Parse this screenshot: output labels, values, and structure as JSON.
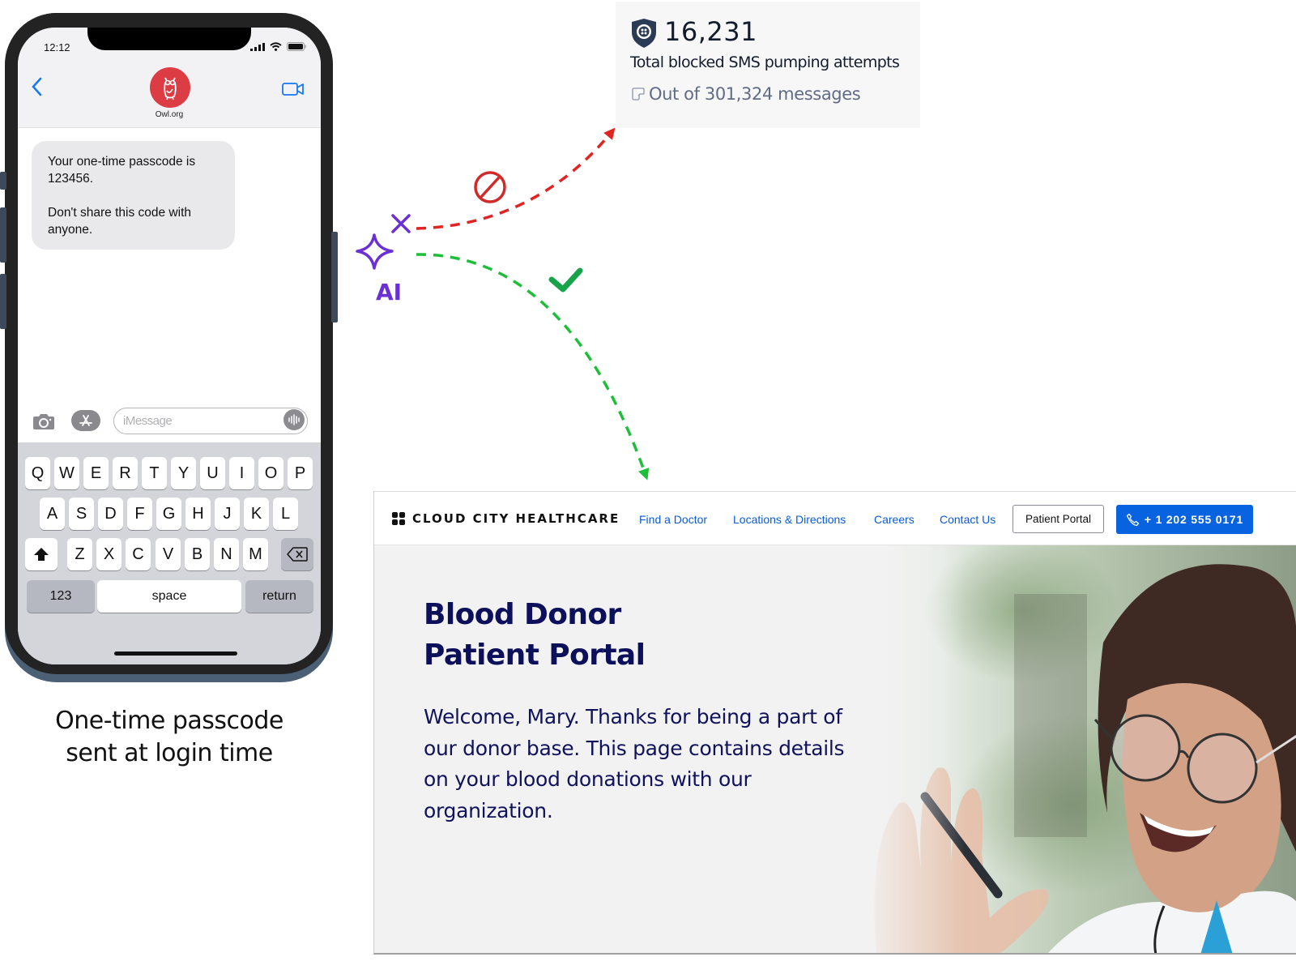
{
  "phone": {
    "status_time": "12:12",
    "contact_name": "Owl.org",
    "messages": [
      {
        "lines": [
          "Your one-time passcode is",
          "123456."
        ],
        "lines2": [
          "Don't share this code with",
          "anyone."
        ]
      }
    ],
    "input_placeholder": "iMessage",
    "keyboard": {
      "row1": [
        "Q",
        "W",
        "E",
        "R",
        "T",
        "Y",
        "U",
        "I",
        "O",
        "P"
      ],
      "row2": [
        "A",
        "S",
        "D",
        "F",
        "G",
        "H",
        "J",
        "K",
        "L"
      ],
      "row3": [
        "Z",
        "X",
        "C",
        "V",
        "B",
        "N",
        "M"
      ],
      "numbers_label": "123",
      "space_label": "space",
      "return_label": "return"
    },
    "caption_line1": "One-time passcode",
    "caption_line2": "sent at login time"
  },
  "stats": {
    "value": "16,231",
    "label": "Total blocked SMS pumping attempts",
    "sub_label": "Out of 301,324 messages"
  },
  "flow": {
    "ai_label": "AI",
    "blocked_color": "#e02424",
    "allowed_color": "#1fbe3a",
    "ai_color": "#6a2fd5"
  },
  "site": {
    "brand_name": "CLOUD CITY HEALTHCARE",
    "nav": [
      "Find a Doctor",
      "Locations & Directions",
      "Careers",
      "Contact Us"
    ],
    "portal_button": "Patient Portal",
    "phone_button": "+ 1 202 555 0171",
    "hero_title_line1": "Blood Donor",
    "hero_title_line2": "Patient Portal",
    "hero_text": "Welcome, Mary. Thanks for being a part of our donor base. This page contains details on your blood donations with our organization."
  }
}
